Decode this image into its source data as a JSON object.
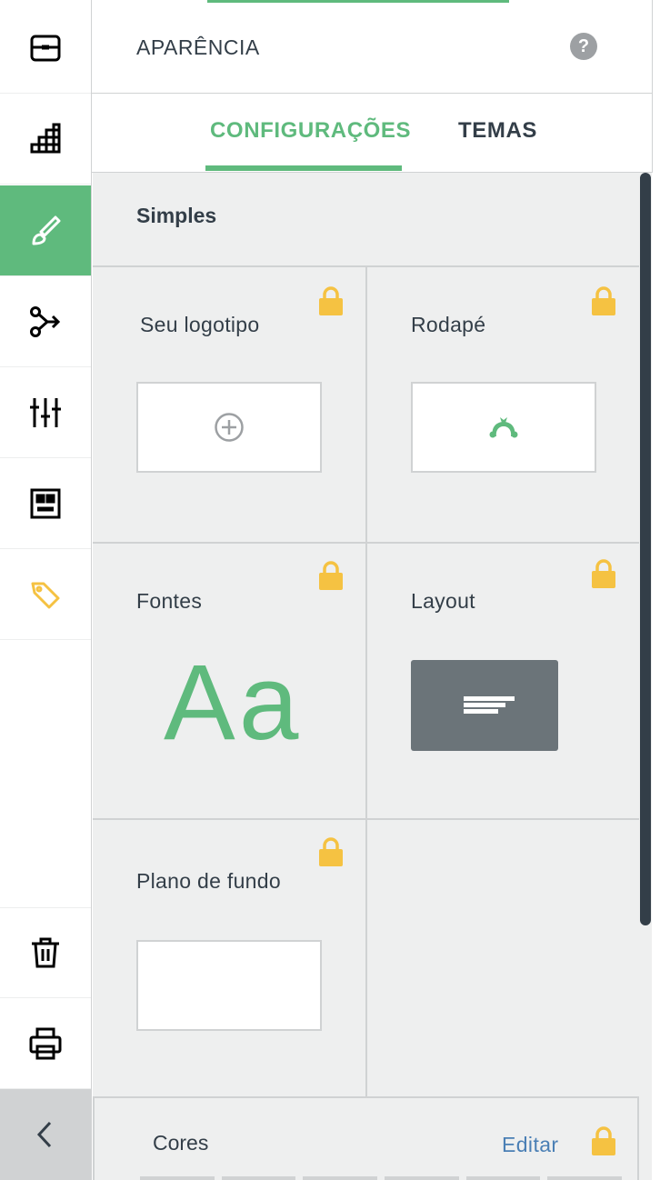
{
  "header": {
    "title": "APARÊNCIA",
    "help_icon": "?"
  },
  "tabs": [
    {
      "label": "CONFIGURAÇÕES",
      "active": true
    },
    {
      "label": "TEMAS",
      "active": false
    }
  ],
  "sidebar": {
    "items": [
      {
        "icon": "suitcase-icon"
      },
      {
        "icon": "bar-chart-icon"
      },
      {
        "icon": "brush-icon",
        "active": true
      },
      {
        "icon": "branch-logic-icon"
      },
      {
        "icon": "sliders-icon"
      },
      {
        "icon": "layout-grid-icon"
      },
      {
        "icon": "price-tag-icon"
      },
      {
        "icon": "trash-icon"
      },
      {
        "icon": "print-icon"
      }
    ],
    "collapse_icon": "chevron-left-icon"
  },
  "section": {
    "title": "Simples",
    "cells": {
      "logo": {
        "label": "Seu logotipo"
      },
      "footer": {
        "label": "Rodapé"
      },
      "fonts": {
        "label": "Fontes",
        "sample": "Aa"
      },
      "layout": {
        "label": "Layout"
      },
      "background": {
        "label": "Plano de fundo"
      }
    }
  },
  "colors": {
    "label": "Cores",
    "edit_label": "Editar"
  },
  "theme": {
    "accent": "#5fba7d",
    "lock": "#f5c242",
    "text": "#333e48",
    "link": "#4a7fb5"
  }
}
